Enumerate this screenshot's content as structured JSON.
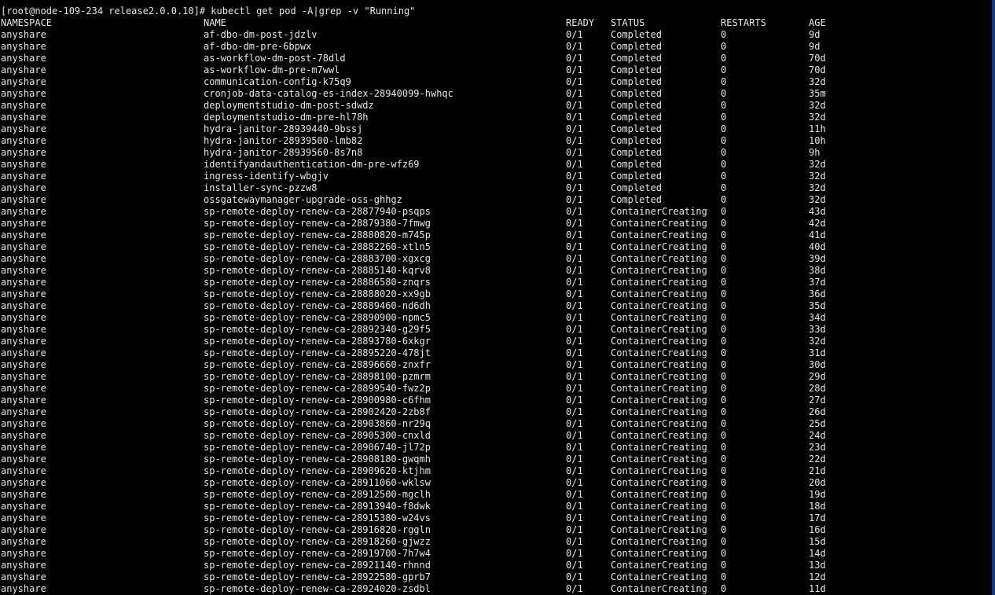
{
  "terminal": {
    "prompt_line": "[root@node-109-234 release2.0.0.10]# kubectl get pod -A|grep -v \"Running\"",
    "headers": {
      "namespace": "NAMESPACE",
      "name": "NAME",
      "ready": "READY",
      "status": "STATUS",
      "restarts": "RESTARTS",
      "age": "AGE"
    },
    "rows": [
      {
        "namespace": "anyshare",
        "name": "af-dbo-dm-post-jdzlv",
        "ready": "0/1",
        "status": "Completed",
        "restarts": "0",
        "age": "9d"
      },
      {
        "namespace": "anyshare",
        "name": "af-dbo-dm-pre-6bpwx",
        "ready": "0/1",
        "status": "Completed",
        "restarts": "0",
        "age": "9d"
      },
      {
        "namespace": "anyshare",
        "name": "as-workflow-dm-post-78dld",
        "ready": "0/1",
        "status": "Completed",
        "restarts": "0",
        "age": "70d"
      },
      {
        "namespace": "anyshare",
        "name": "as-workflow-dm-pre-m7wwl",
        "ready": "0/1",
        "status": "Completed",
        "restarts": "0",
        "age": "70d"
      },
      {
        "namespace": "anyshare",
        "name": "communication-config-k75q9",
        "ready": "0/1",
        "status": "Completed",
        "restarts": "0",
        "age": "32d"
      },
      {
        "namespace": "anyshare",
        "name": "cronjob-data-catalog-es-index-28940099-hwhqc",
        "ready": "0/1",
        "status": "Completed",
        "restarts": "0",
        "age": "35m"
      },
      {
        "namespace": "anyshare",
        "name": "deploymentstudio-dm-post-sdwdz",
        "ready": "0/1",
        "status": "Completed",
        "restarts": "0",
        "age": "32d"
      },
      {
        "namespace": "anyshare",
        "name": "deploymentstudio-dm-pre-hl78h",
        "ready": "0/1",
        "status": "Completed",
        "restarts": "0",
        "age": "32d"
      },
      {
        "namespace": "anyshare",
        "name": "hydra-janitor-28939440-9bssj",
        "ready": "0/1",
        "status": "Completed",
        "restarts": "0",
        "age": "11h"
      },
      {
        "namespace": "anyshare",
        "name": "hydra-janitor-28939500-lmb82",
        "ready": "0/1",
        "status": "Completed",
        "restarts": "0",
        "age": "10h"
      },
      {
        "namespace": "anyshare",
        "name": "hydra-janitor-28939560-8s7n8",
        "ready": "0/1",
        "status": "Completed",
        "restarts": "0",
        "age": "9h"
      },
      {
        "namespace": "anyshare",
        "name": "identifyandauthentication-dm-pre-wfz69",
        "ready": "0/1",
        "status": "Completed",
        "restarts": "0",
        "age": "32d"
      },
      {
        "namespace": "anyshare",
        "name": "ingress-identify-wbgjv",
        "ready": "0/1",
        "status": "Completed",
        "restarts": "0",
        "age": "32d"
      },
      {
        "namespace": "anyshare",
        "name": "installer-sync-pzzw8",
        "ready": "0/1",
        "status": "Completed",
        "restarts": "0",
        "age": "32d"
      },
      {
        "namespace": "anyshare",
        "name": "ossgatewaymanager-upgrade-oss-ghhgz",
        "ready": "0/1",
        "status": "Completed",
        "restarts": "0",
        "age": "32d"
      },
      {
        "namespace": "anyshare",
        "name": "sp-remote-deploy-renew-ca-28877940-psqps",
        "ready": "0/1",
        "status": "ContainerCreating",
        "restarts": "0",
        "age": "43d"
      },
      {
        "namespace": "anyshare",
        "name": "sp-remote-deploy-renew-ca-28879380-7fmwg",
        "ready": "0/1",
        "status": "ContainerCreating",
        "restarts": "0",
        "age": "42d"
      },
      {
        "namespace": "anyshare",
        "name": "sp-remote-deploy-renew-ca-28880820-m745p",
        "ready": "0/1",
        "status": "ContainerCreating",
        "restarts": "0",
        "age": "41d"
      },
      {
        "namespace": "anyshare",
        "name": "sp-remote-deploy-renew-ca-28882260-xtln5",
        "ready": "0/1",
        "status": "ContainerCreating",
        "restarts": "0",
        "age": "40d"
      },
      {
        "namespace": "anyshare",
        "name": "sp-remote-deploy-renew-ca-28883700-xgxcg",
        "ready": "0/1",
        "status": "ContainerCreating",
        "restarts": "0",
        "age": "39d"
      },
      {
        "namespace": "anyshare",
        "name": "sp-remote-deploy-renew-ca-28885140-kqrv8",
        "ready": "0/1",
        "status": "ContainerCreating",
        "restarts": "0",
        "age": "38d"
      },
      {
        "namespace": "anyshare",
        "name": "sp-remote-deploy-renew-ca-28886580-znqrs",
        "ready": "0/1",
        "status": "ContainerCreating",
        "restarts": "0",
        "age": "37d"
      },
      {
        "namespace": "anyshare",
        "name": "sp-remote-deploy-renew-ca-28888020-xx9gb",
        "ready": "0/1",
        "status": "ContainerCreating",
        "restarts": "0",
        "age": "36d"
      },
      {
        "namespace": "anyshare",
        "name": "sp-remote-deploy-renew-ca-28889460-nd6dh",
        "ready": "0/1",
        "status": "ContainerCreating",
        "restarts": "0",
        "age": "35d"
      },
      {
        "namespace": "anyshare",
        "name": "sp-remote-deploy-renew-ca-28890900-npmc5",
        "ready": "0/1",
        "status": "ContainerCreating",
        "restarts": "0",
        "age": "34d"
      },
      {
        "namespace": "anyshare",
        "name": "sp-remote-deploy-renew-ca-28892340-g29f5",
        "ready": "0/1",
        "status": "ContainerCreating",
        "restarts": "0",
        "age": "33d"
      },
      {
        "namespace": "anyshare",
        "name": "sp-remote-deploy-renew-ca-28893780-6xkgr",
        "ready": "0/1",
        "status": "ContainerCreating",
        "restarts": "0",
        "age": "32d"
      },
      {
        "namespace": "anyshare",
        "name": "sp-remote-deploy-renew-ca-28895220-478jt",
        "ready": "0/1",
        "status": "ContainerCreating",
        "restarts": "0",
        "age": "31d"
      },
      {
        "namespace": "anyshare",
        "name": "sp-remote-deploy-renew-ca-28896660-znxfr",
        "ready": "0/1",
        "status": "ContainerCreating",
        "restarts": "0",
        "age": "30d"
      },
      {
        "namespace": "anyshare",
        "name": "sp-remote-deploy-renew-ca-28898100-pzmrm",
        "ready": "0/1",
        "status": "ContainerCreating",
        "restarts": "0",
        "age": "29d"
      },
      {
        "namespace": "anyshare",
        "name": "sp-remote-deploy-renew-ca-28899540-fwz2p",
        "ready": "0/1",
        "status": "ContainerCreating",
        "restarts": "0",
        "age": "28d"
      },
      {
        "namespace": "anyshare",
        "name": "sp-remote-deploy-renew-ca-28900980-c6fhm",
        "ready": "0/1",
        "status": "ContainerCreating",
        "restarts": "0",
        "age": "27d"
      },
      {
        "namespace": "anyshare",
        "name": "sp-remote-deploy-renew-ca-28902420-2zb8f",
        "ready": "0/1",
        "status": "ContainerCreating",
        "restarts": "0",
        "age": "26d"
      },
      {
        "namespace": "anyshare",
        "name": "sp-remote-deploy-renew-ca-28903860-nr29q",
        "ready": "0/1",
        "status": "ContainerCreating",
        "restarts": "0",
        "age": "25d"
      },
      {
        "namespace": "anyshare",
        "name": "sp-remote-deploy-renew-ca-28905300-cnxld",
        "ready": "0/1",
        "status": "ContainerCreating",
        "restarts": "0",
        "age": "24d"
      },
      {
        "namespace": "anyshare",
        "name": "sp-remote-deploy-renew-ca-28906740-jl72p",
        "ready": "0/1",
        "status": "ContainerCreating",
        "restarts": "0",
        "age": "23d"
      },
      {
        "namespace": "anyshare",
        "name": "sp-remote-deploy-renew-ca-28908180-gwqmh",
        "ready": "0/1",
        "status": "ContainerCreating",
        "restarts": "0",
        "age": "22d"
      },
      {
        "namespace": "anyshare",
        "name": "sp-remote-deploy-renew-ca-28909620-ktjhm",
        "ready": "0/1",
        "status": "ContainerCreating",
        "restarts": "0",
        "age": "21d"
      },
      {
        "namespace": "anyshare",
        "name": "sp-remote-deploy-renew-ca-28911060-wklsw",
        "ready": "0/1",
        "status": "ContainerCreating",
        "restarts": "0",
        "age": "20d"
      },
      {
        "namespace": "anyshare",
        "name": "sp-remote-deploy-renew-ca-28912500-mgclh",
        "ready": "0/1",
        "status": "ContainerCreating",
        "restarts": "0",
        "age": "19d"
      },
      {
        "namespace": "anyshare",
        "name": "sp-remote-deploy-renew-ca-28913940-f8dwk",
        "ready": "0/1",
        "status": "ContainerCreating",
        "restarts": "0",
        "age": "18d"
      },
      {
        "namespace": "anyshare",
        "name": "sp-remote-deploy-renew-ca-28915380-w24vs",
        "ready": "0/1",
        "status": "ContainerCreating",
        "restarts": "0",
        "age": "17d"
      },
      {
        "namespace": "anyshare",
        "name": "sp-remote-deploy-renew-ca-28916820-rggln",
        "ready": "0/1",
        "status": "ContainerCreating",
        "restarts": "0",
        "age": "16d"
      },
      {
        "namespace": "anyshare",
        "name": "sp-remote-deploy-renew-ca-28918260-gjwzz",
        "ready": "0/1",
        "status": "ContainerCreating",
        "restarts": "0",
        "age": "15d"
      },
      {
        "namespace": "anyshare",
        "name": "sp-remote-deploy-renew-ca-28919700-7h7w4",
        "ready": "0/1",
        "status": "ContainerCreating",
        "restarts": "0",
        "age": "14d"
      },
      {
        "namespace": "anyshare",
        "name": "sp-remote-deploy-renew-ca-28921140-rhnnd",
        "ready": "0/1",
        "status": "ContainerCreating",
        "restarts": "0",
        "age": "13d"
      },
      {
        "namespace": "anyshare",
        "name": "sp-remote-deploy-renew-ca-28922580-gprb7",
        "ready": "0/1",
        "status": "ContainerCreating",
        "restarts": "0",
        "age": "12d"
      },
      {
        "namespace": "anyshare",
        "name": "sp-remote-deploy-renew-ca-28924020-zsdbl",
        "ready": "0/1",
        "status": "ContainerCreating",
        "restarts": "0",
        "age": "11d"
      }
    ]
  }
}
